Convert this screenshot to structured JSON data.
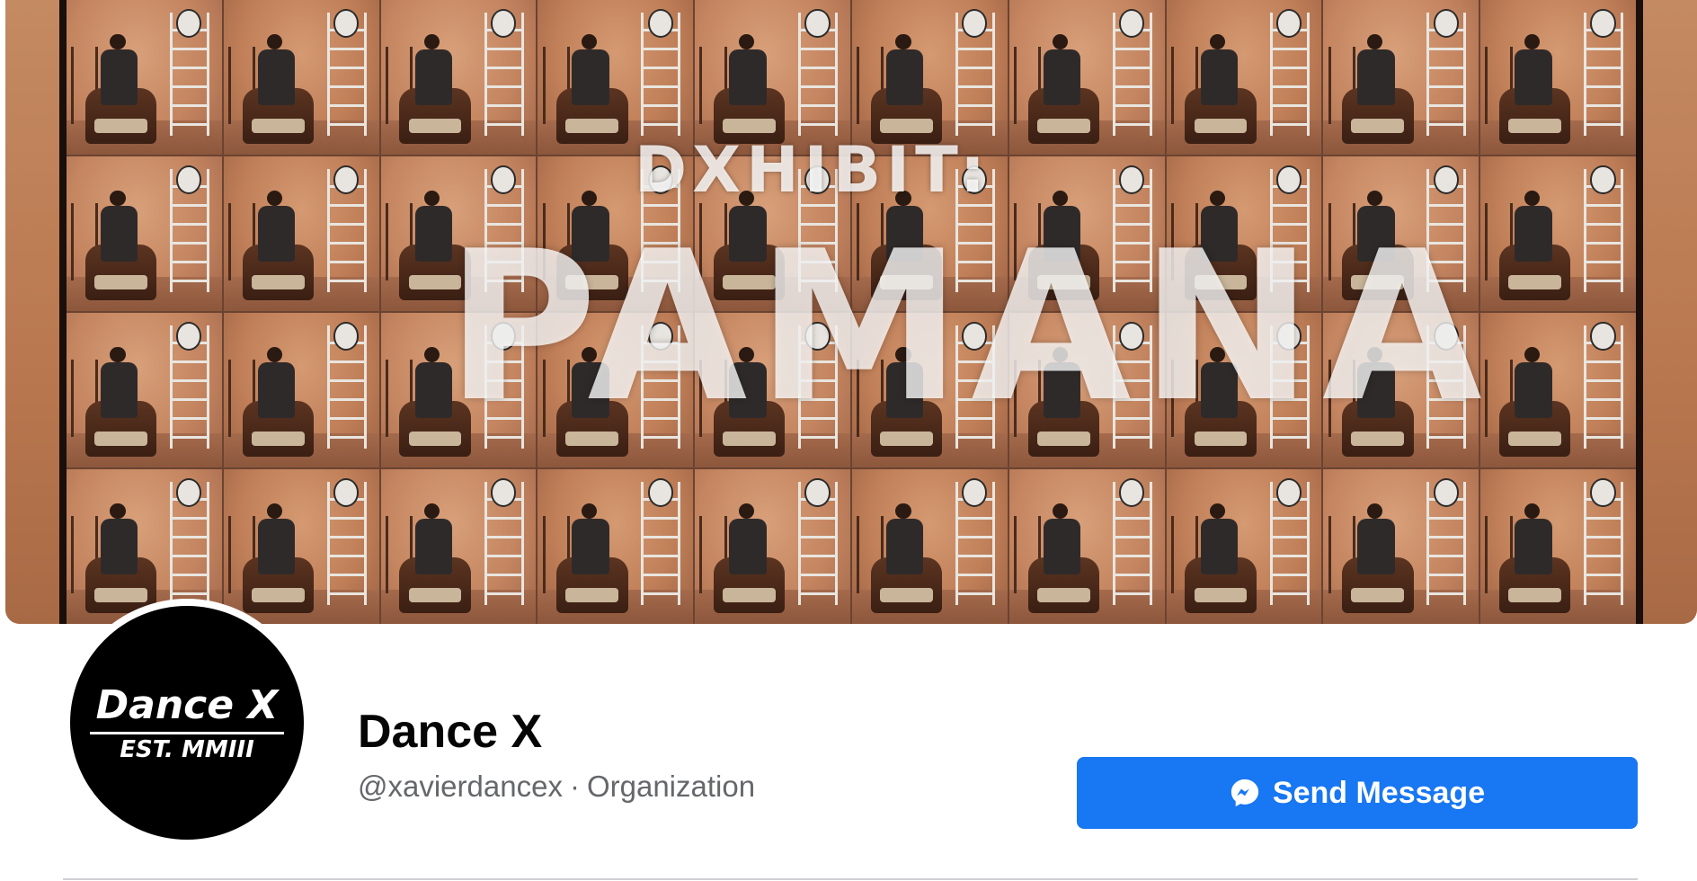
{
  "cover": {
    "subtitle": "DXHIBIT:",
    "title": "PAMANA"
  },
  "avatar": {
    "title": "Dance X",
    "est": "EST. MMIII"
  },
  "profile": {
    "name": "Dance X",
    "handle": "@xavierdancex",
    "separator": "·",
    "category": "Organization"
  },
  "actions": {
    "send_message_label": "Send Message",
    "send_message_icon": "messenger-icon",
    "button_color": "#1877f2"
  }
}
